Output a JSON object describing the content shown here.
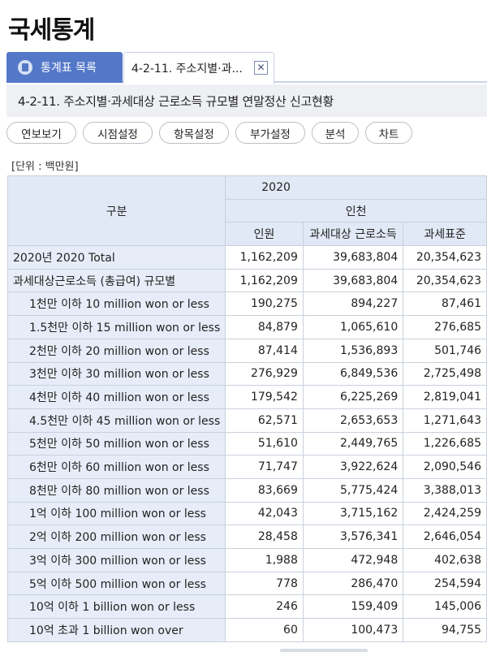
{
  "app_title": "국세통계",
  "tabs": {
    "list_label": "통계표 목록",
    "active_label": "4-2-11. 주소지별·과...",
    "close_icon": "x-icon"
  },
  "table_title": "4-2-11. 주소지별·과세대상 근로소득 규모별 연말정산 신고현황",
  "toolbar": [
    "연보보기",
    "시점설정",
    "항목설정",
    "부가설정",
    "분석",
    "차트"
  ],
  "unit": "[단위 : 백만원]",
  "table": {
    "stub_header": "구분",
    "year": "2020",
    "region": "인천",
    "columns": [
      "인원",
      "과세대상 근로소득",
      "과세표준"
    ],
    "rows": [
      {
        "label": "2020년 2020 Total",
        "values": [
          "1,162,209",
          "39,683,804",
          "20,354,623"
        ]
      },
      {
        "label": "과세대상근로소득 (총급여) 규모별",
        "values": [
          "1,162,209",
          "39,683,804",
          "20,354,623"
        ]
      },
      {
        "label": "1천만 이하 10 million won or less",
        "values": [
          "190,275",
          "894,227",
          "87,461"
        ]
      },
      {
        "label": "1.5천만 이하 15 million won or less",
        "values": [
          "84,879",
          "1,065,610",
          "276,685"
        ]
      },
      {
        "label": "2천만 이하 20 million won or less",
        "values": [
          "87,414",
          "1,536,893",
          "501,746"
        ]
      },
      {
        "label": "3천만 이하 30 million won or less",
        "values": [
          "276,929",
          "6,849,536",
          "2,725,498"
        ]
      },
      {
        "label": "4천만 이하 40 million won or less",
        "values": [
          "179,542",
          "6,225,269",
          "2,819,041"
        ]
      },
      {
        "label": "4.5천만 이하 45 million won or less",
        "values": [
          "62,571",
          "2,653,653",
          "1,271,643"
        ]
      },
      {
        "label": "5천만 이하 50 million won or less",
        "values": [
          "51,610",
          "2,449,765",
          "1,226,685"
        ]
      },
      {
        "label": "6천만 이하 60 million won or less",
        "values": [
          "71,747",
          "3,922,624",
          "2,090,546"
        ]
      },
      {
        "label": "8천만 이하 80 million won or less",
        "values": [
          "83,669",
          "5,775,424",
          "3,388,013"
        ]
      },
      {
        "label": "1억 이하 100 million won or less",
        "values": [
          "42,043",
          "3,715,162",
          "2,424,259"
        ]
      },
      {
        "label": "2억 이하 200 million won or less",
        "values": [
          "28,458",
          "3,576,341",
          "2,646,054"
        ]
      },
      {
        "label": "3억 이하 300 million won or less",
        "values": [
          "1,988",
          "472,948",
          "402,638"
        ]
      },
      {
        "label": "5억 이하 500 million won or less",
        "values": [
          "778",
          "286,470",
          "254,594"
        ]
      },
      {
        "label": "10억 이하 1 billion won or less",
        "values": [
          "246",
          "159,409",
          "145,006"
        ]
      },
      {
        "label": "10억 초과 1 billion won over",
        "values": [
          "60",
          "100,473",
          "94,755"
        ]
      }
    ]
  }
}
